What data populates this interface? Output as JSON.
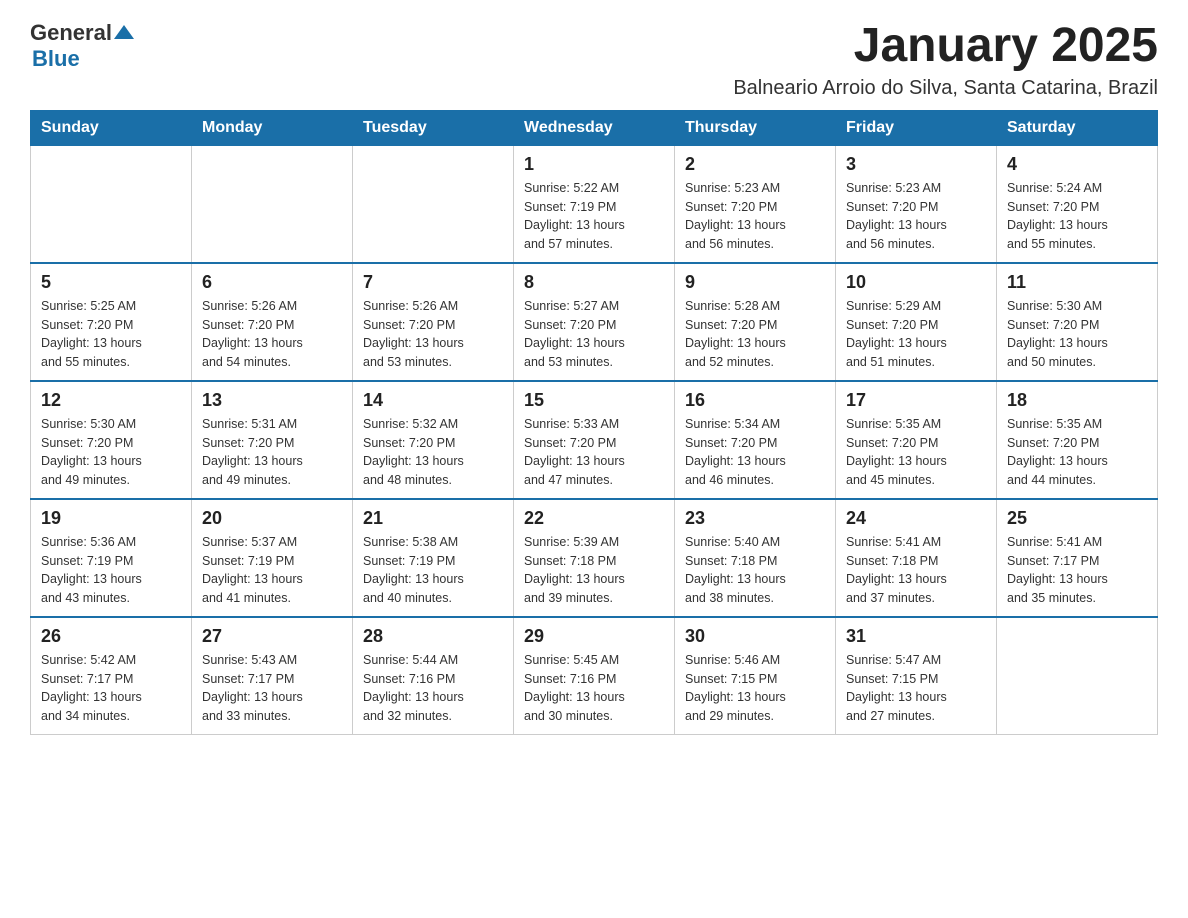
{
  "logo": {
    "general": "General",
    "blue": "Blue"
  },
  "title": "January 2025",
  "location": "Balneario Arroio do Silva, Santa Catarina, Brazil",
  "weekdays": [
    "Sunday",
    "Monday",
    "Tuesday",
    "Wednesday",
    "Thursday",
    "Friday",
    "Saturday"
  ],
  "weeks": [
    [
      {
        "day": "",
        "info": ""
      },
      {
        "day": "",
        "info": ""
      },
      {
        "day": "",
        "info": ""
      },
      {
        "day": "1",
        "info": "Sunrise: 5:22 AM\nSunset: 7:19 PM\nDaylight: 13 hours\nand 57 minutes."
      },
      {
        "day": "2",
        "info": "Sunrise: 5:23 AM\nSunset: 7:20 PM\nDaylight: 13 hours\nand 56 minutes."
      },
      {
        "day": "3",
        "info": "Sunrise: 5:23 AM\nSunset: 7:20 PM\nDaylight: 13 hours\nand 56 minutes."
      },
      {
        "day": "4",
        "info": "Sunrise: 5:24 AM\nSunset: 7:20 PM\nDaylight: 13 hours\nand 55 minutes."
      }
    ],
    [
      {
        "day": "5",
        "info": "Sunrise: 5:25 AM\nSunset: 7:20 PM\nDaylight: 13 hours\nand 55 minutes."
      },
      {
        "day": "6",
        "info": "Sunrise: 5:26 AM\nSunset: 7:20 PM\nDaylight: 13 hours\nand 54 minutes."
      },
      {
        "day": "7",
        "info": "Sunrise: 5:26 AM\nSunset: 7:20 PM\nDaylight: 13 hours\nand 53 minutes."
      },
      {
        "day": "8",
        "info": "Sunrise: 5:27 AM\nSunset: 7:20 PM\nDaylight: 13 hours\nand 53 minutes."
      },
      {
        "day": "9",
        "info": "Sunrise: 5:28 AM\nSunset: 7:20 PM\nDaylight: 13 hours\nand 52 minutes."
      },
      {
        "day": "10",
        "info": "Sunrise: 5:29 AM\nSunset: 7:20 PM\nDaylight: 13 hours\nand 51 minutes."
      },
      {
        "day": "11",
        "info": "Sunrise: 5:30 AM\nSunset: 7:20 PM\nDaylight: 13 hours\nand 50 minutes."
      }
    ],
    [
      {
        "day": "12",
        "info": "Sunrise: 5:30 AM\nSunset: 7:20 PM\nDaylight: 13 hours\nand 49 minutes."
      },
      {
        "day": "13",
        "info": "Sunrise: 5:31 AM\nSunset: 7:20 PM\nDaylight: 13 hours\nand 49 minutes."
      },
      {
        "day": "14",
        "info": "Sunrise: 5:32 AM\nSunset: 7:20 PM\nDaylight: 13 hours\nand 48 minutes."
      },
      {
        "day": "15",
        "info": "Sunrise: 5:33 AM\nSunset: 7:20 PM\nDaylight: 13 hours\nand 47 minutes."
      },
      {
        "day": "16",
        "info": "Sunrise: 5:34 AM\nSunset: 7:20 PM\nDaylight: 13 hours\nand 46 minutes."
      },
      {
        "day": "17",
        "info": "Sunrise: 5:35 AM\nSunset: 7:20 PM\nDaylight: 13 hours\nand 45 minutes."
      },
      {
        "day": "18",
        "info": "Sunrise: 5:35 AM\nSunset: 7:20 PM\nDaylight: 13 hours\nand 44 minutes."
      }
    ],
    [
      {
        "day": "19",
        "info": "Sunrise: 5:36 AM\nSunset: 7:19 PM\nDaylight: 13 hours\nand 43 minutes."
      },
      {
        "day": "20",
        "info": "Sunrise: 5:37 AM\nSunset: 7:19 PM\nDaylight: 13 hours\nand 41 minutes."
      },
      {
        "day": "21",
        "info": "Sunrise: 5:38 AM\nSunset: 7:19 PM\nDaylight: 13 hours\nand 40 minutes."
      },
      {
        "day": "22",
        "info": "Sunrise: 5:39 AM\nSunset: 7:18 PM\nDaylight: 13 hours\nand 39 minutes."
      },
      {
        "day": "23",
        "info": "Sunrise: 5:40 AM\nSunset: 7:18 PM\nDaylight: 13 hours\nand 38 minutes."
      },
      {
        "day": "24",
        "info": "Sunrise: 5:41 AM\nSunset: 7:18 PM\nDaylight: 13 hours\nand 37 minutes."
      },
      {
        "day": "25",
        "info": "Sunrise: 5:41 AM\nSunset: 7:17 PM\nDaylight: 13 hours\nand 35 minutes."
      }
    ],
    [
      {
        "day": "26",
        "info": "Sunrise: 5:42 AM\nSunset: 7:17 PM\nDaylight: 13 hours\nand 34 minutes."
      },
      {
        "day": "27",
        "info": "Sunrise: 5:43 AM\nSunset: 7:17 PM\nDaylight: 13 hours\nand 33 minutes."
      },
      {
        "day": "28",
        "info": "Sunrise: 5:44 AM\nSunset: 7:16 PM\nDaylight: 13 hours\nand 32 minutes."
      },
      {
        "day": "29",
        "info": "Sunrise: 5:45 AM\nSunset: 7:16 PM\nDaylight: 13 hours\nand 30 minutes."
      },
      {
        "day": "30",
        "info": "Sunrise: 5:46 AM\nSunset: 7:15 PM\nDaylight: 13 hours\nand 29 minutes."
      },
      {
        "day": "31",
        "info": "Sunrise: 5:47 AM\nSunset: 7:15 PM\nDaylight: 13 hours\nand 27 minutes."
      },
      {
        "day": "",
        "info": ""
      }
    ]
  ]
}
